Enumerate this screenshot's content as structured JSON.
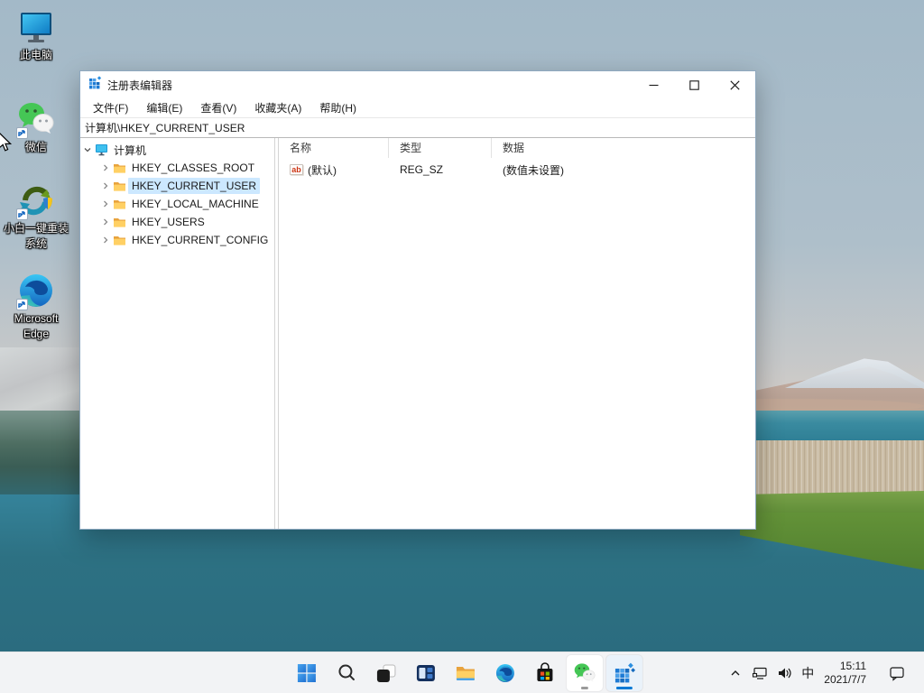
{
  "desktop": {
    "icons": [
      {
        "id": "this-pc",
        "line1": "此电脑",
        "line2": ""
      },
      {
        "id": "wechat",
        "line1": "微信",
        "line2": ""
      },
      {
        "id": "xiaobai-reinstall",
        "line1": "小白一键重装",
        "line2": "系统"
      },
      {
        "id": "microsoft-edge",
        "line1": "Microsoft",
        "line2": "Edge"
      }
    ]
  },
  "window": {
    "title": "注册表编辑器",
    "menus": [
      "文件(F)",
      "编辑(E)",
      "查看(V)",
      "收藏夹(A)",
      "帮助(H)"
    ],
    "address": "计算机\\HKEY_CURRENT_USER",
    "tree": {
      "root": "计算机",
      "items": [
        "HKEY_CLASSES_ROOT",
        "HKEY_CURRENT_USER",
        "HKEY_LOCAL_MACHINE",
        "HKEY_USERS",
        "HKEY_CURRENT_CONFIG"
      ],
      "selected": "HKEY_CURRENT_USER"
    },
    "list": {
      "columns": [
        "名称",
        "类型",
        "数据"
      ],
      "rows": [
        {
          "name": "(默认)",
          "type": "REG_SZ",
          "data": "(数值未设置)"
        }
      ]
    }
  },
  "icons": {
    "reg_sz": "ab"
  },
  "taskbar": {
    "buttons": [
      "start",
      "search",
      "desktop-app",
      "task-view",
      "file-explorer",
      "edge",
      "store",
      "wechat",
      "registry-editor"
    ],
    "tray": {
      "ime": "中",
      "time": "15:11",
      "date": "2021/7/7"
    }
  },
  "colors": {
    "accent": "#0078d4",
    "tree_selection": "#cce8ff",
    "taskbar_bg": "#f2f3f5",
    "window_bg": "#ffffff"
  }
}
